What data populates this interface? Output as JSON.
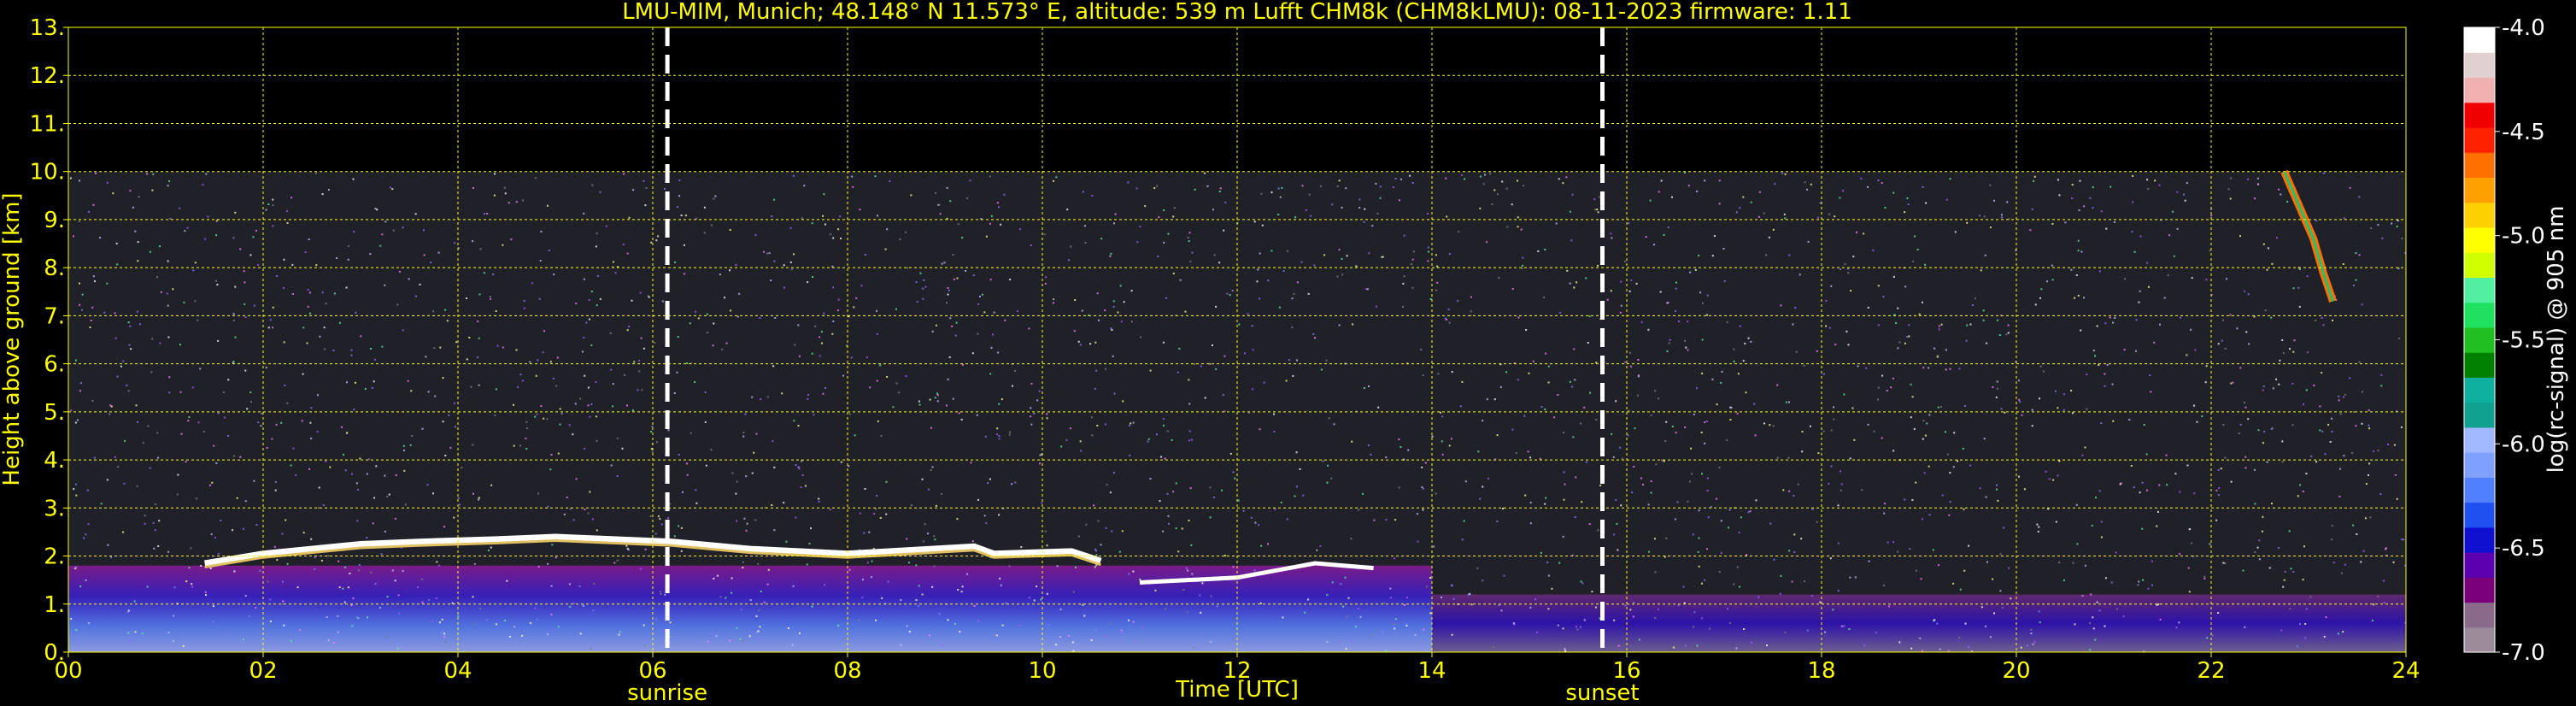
{
  "chart_data": {
    "type": "heatmap",
    "title": "LMU-MIM, Munich; 48.148° N 11.573° E, altitude: 539 m    Lufft CHM8k (CHM8kLMU): 08-11-2023    firmware: 1.11",
    "xlabel": "Time [UTC]",
    "ylabel": "Height above ground [km]",
    "xlim": [
      0,
      24
    ],
    "ylim": [
      0,
      13
    ],
    "x_ticks": [
      "00",
      "02",
      "04",
      "06",
      "08",
      "10",
      "12",
      "14",
      "16",
      "18",
      "20",
      "22",
      "24"
    ],
    "y_ticks": [
      "0.",
      "1.",
      "2.",
      "3.",
      "4.",
      "5.",
      "6.",
      "7.",
      "8.",
      "9.",
      "10.",
      "11.",
      "12.",
      "13."
    ],
    "grid": true,
    "measurement_top_km": 10,
    "events": [
      {
        "name": "sunrise",
        "x": 6.15
      },
      {
        "name": "sunset",
        "x": 15.75
      }
    ],
    "colorbar": {
      "label": "log(rc-signal) @ 905 nm",
      "ticks": [
        "-4.0",
        "-4.5",
        "-5.0",
        "-5.5",
        "-6.0",
        "-6.5",
        "-7.0"
      ],
      "range": [
        -7.0,
        -4.0
      ],
      "colors": [
        "#9a8a9a",
        "#8a6a8a",
        "#7a007a",
        "#5a00b0",
        "#1010d0",
        "#2050f0",
        "#5080ff",
        "#80a0ff",
        "#a0b8ff",
        "#10a090",
        "#10b0a0",
        "#008000",
        "#20c020",
        "#20e060",
        "#50f0a0",
        "#d0ff00",
        "#ffff00",
        "#ffd000",
        "#ffa000",
        "#ff7000",
        "#ff2000",
        "#f00000",
        "#f0b0b0",
        "#e0d0d0",
        "#ffffff"
      ]
    },
    "cloud_layer": [
      [
        1.4,
        1.85
      ],
      [
        2.0,
        2.05
      ],
      [
        2.5,
        2.15
      ],
      [
        3.0,
        2.25
      ],
      [
        3.6,
        2.3
      ],
      [
        4.4,
        2.35
      ],
      [
        5.0,
        2.4
      ],
      [
        5.6,
        2.35
      ],
      [
        6.2,
        2.3
      ],
      [
        7.0,
        2.15
      ],
      [
        8.0,
        2.05
      ],
      [
        9.3,
        2.2
      ],
      [
        9.5,
        2.05
      ],
      [
        10.3,
        2.1
      ],
      [
        10.6,
        1.9
      ]
    ],
    "cloud_layer_2": [
      [
        11.0,
        1.45
      ],
      [
        12.0,
        1.55
      ],
      [
        12.8,
        1.85
      ],
      [
        13.4,
        1.75
      ]
    ],
    "upper_cloud": [
      [
        22.75,
        10.0
      ],
      [
        22.9,
        9.3
      ],
      [
        23.05,
        8.6
      ],
      [
        23.15,
        7.9
      ],
      [
        23.25,
        7.3
      ]
    ]
  }
}
